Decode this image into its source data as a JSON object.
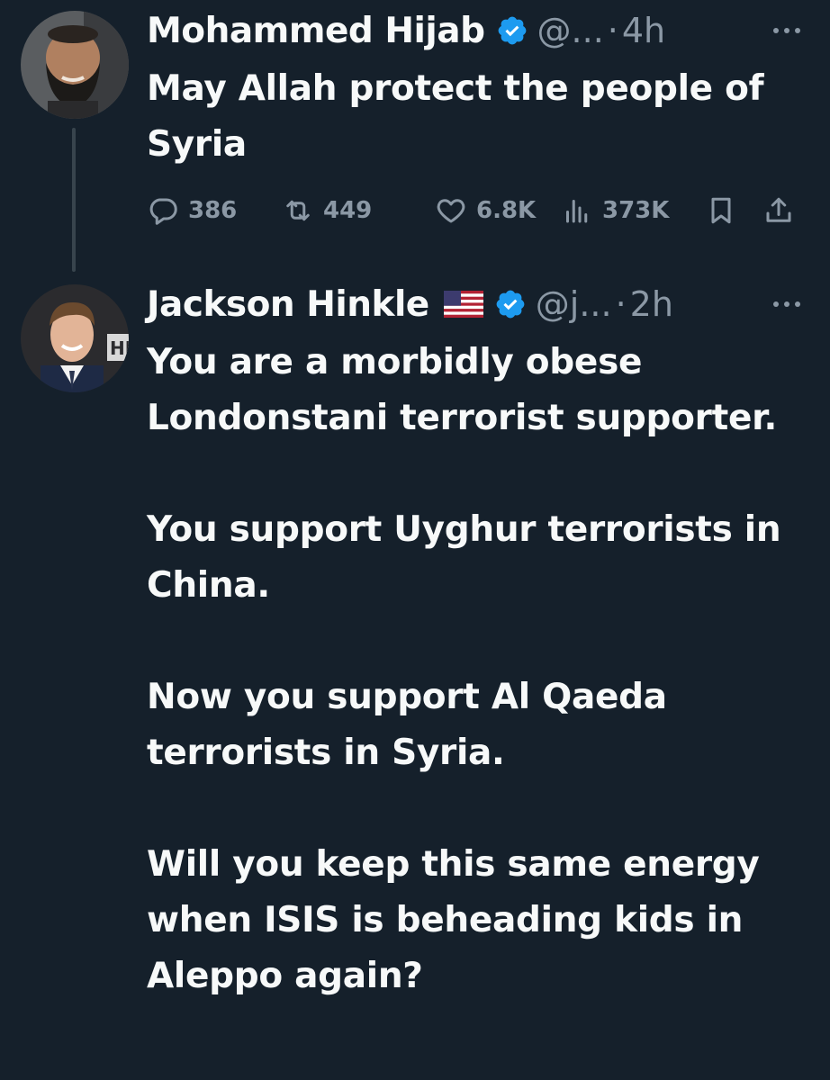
{
  "tweets": [
    {
      "display_name": "Mohammed Hijab",
      "handle": "@...",
      "separator": "·",
      "time": "4h",
      "body": [
        "May Allah protect the people of Syria"
      ],
      "stats": {
        "replies": "386",
        "retweets": "449",
        "likes": "6.8K",
        "views": "373K"
      }
    },
    {
      "display_name": "Jackson Hinkle",
      "flag": "us-flag-emoji",
      "handle": "@j...",
      "separator": "·",
      "time": "2h",
      "body": [
        "You are a morbidly obese Londonstani terrorist supporter.",
        "You support Uyghur terrorists in China.",
        "Now you support Al Qaeda terrorists in Syria.",
        "Will you keep this same energy when ISIS is beheading kids in Aleppo again?"
      ]
    }
  ],
  "icons": {
    "verified": "verified-badge-icon",
    "more": "more-dots-icon",
    "reply": "reply-icon",
    "retweet": "retweet-icon",
    "like": "heart-icon",
    "views": "views-chart-icon",
    "bookmark": "bookmark-icon",
    "share": "share-icon"
  },
  "colors": {
    "background": "#15202b",
    "text": "#f7f9f9",
    "secondary": "#8b98a5",
    "verified": "#1d9bf0",
    "thread_line": "#38444d"
  }
}
